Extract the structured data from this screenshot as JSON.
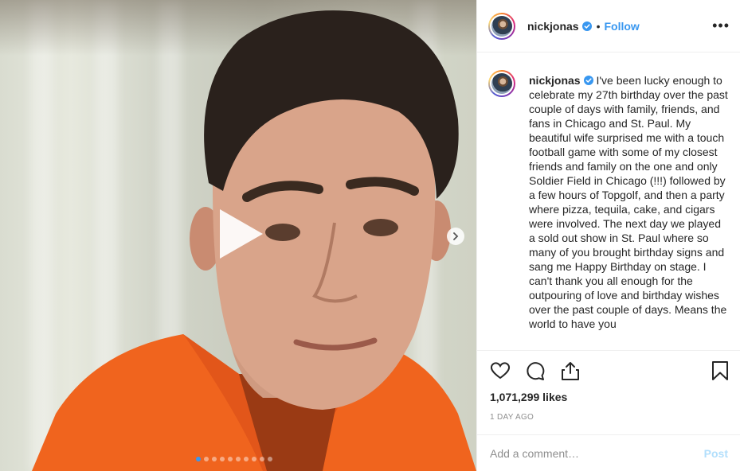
{
  "post": {
    "username": "nickjonas",
    "header_separator": "•",
    "follow_label": "Follow",
    "more_label": "•••",
    "caption": "I've been lucky enough to celebrate my 27th birthday over the past couple of days with family, friends, and fans in Chicago and St. Paul. My beautiful wife surprised me with a touch football game with some of my closest friends and family on the one and only Soldier Field in Chicago (!!!) followed by a few hours of Topgolf, and then a party where pizza, tequila, cake, and cigars were involved. The next day we played a sold out show in St. Paul where so many of you brought birthday signs and sang me Happy Birthday on stage. I can't thank you all enough for the outpouring of love and birthday wishes over the past couple of days. Means the world to have you",
    "likes": "1,071,299 likes",
    "timestamp": "1 DAY AGO",
    "comment_placeholder": "Add a comment…",
    "post_label": "Post"
  },
  "carousel": {
    "slide_count": 10,
    "active_slide": 1
  },
  "icons": {
    "play": "play-icon",
    "next": "chevron-right-icon",
    "verified": "verified-badge-icon",
    "like": "heart-icon",
    "comment": "comment-icon",
    "share": "share-icon",
    "save": "bookmark-icon",
    "more": "more-options-icon"
  },
  "colors": {
    "link_blue": "#3897f0",
    "post_disabled": "#b2dffc",
    "muted_text": "#8e8e8e",
    "text": "#262626",
    "divider": "#efefef"
  }
}
